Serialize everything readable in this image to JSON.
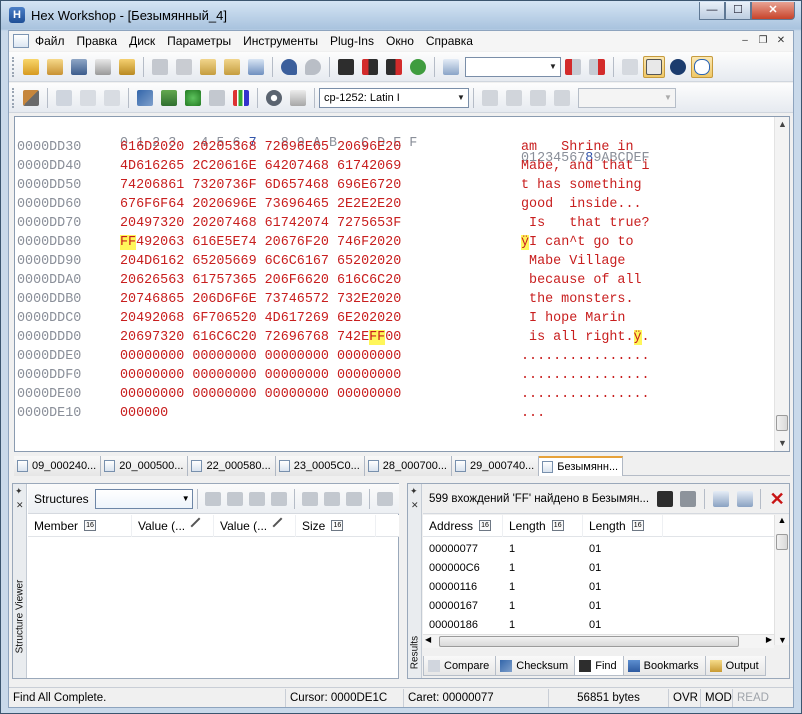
{
  "window": {
    "title": "Hex Workshop - [Безымянный_4]",
    "app_icon_letter": "H",
    "buttons": {
      "minimize": "—",
      "maximize": "☐",
      "close": "✕"
    }
  },
  "menu": {
    "items": [
      "Файл",
      "Правка",
      "Диск",
      "Параметры",
      "Инструменты",
      "Plug-Ins",
      "Окно",
      "Справка"
    ],
    "mdi_buttons": {
      "minimize": "–",
      "restore": "❐",
      "close": "✕"
    }
  },
  "toolbar2": {
    "codepage": "cp-1252: Latin I"
  },
  "hex": {
    "header_offsets": "  0 1 2 3   4 5 6 7   8 9 A B   C D E F   0123456789ABCDEF",
    "rows": [
      {
        "addr": "0000DD30",
        "bytes": "616D2020 20205368 72696E65 20696E20",
        "ascii": "am   Shrine in"
      },
      {
        "addr": "0000DD40",
        "bytes": "4D616265 2C20616E 64207468 61742069",
        "ascii": "Mabe, and that i"
      },
      {
        "addr": "0000DD50",
        "bytes": "74206861 7320736F 6D657468 696E6720",
        "ascii": "t has something "
      },
      {
        "addr": "0000DD60",
        "bytes": "676F6F64 2020696E 73696465 2E2E2E20",
        "ascii": "good  inside... "
      },
      {
        "addr": "0000DD70",
        "bytes": "20497320 20207468 61742074 7275653F",
        "ascii": " Is   that true?"
      },
      {
        "addr": "0000DD80",
        "bytes_pre": "",
        "bytes_hl": "FF",
        "bytes_post": "492063 616E5E74 20676F20 746F2020",
        "ascii_pre": "",
        "ascii_hl": "ÿ",
        "ascii_post": "I can^t go to  "
      },
      {
        "addr": "0000DD90",
        "bytes": "204D6162 65205669 6C6C6167 65202020",
        "ascii": " Mabe Village   "
      },
      {
        "addr": "0000DDA0",
        "bytes": "20626563 61757365 206F6620 616C6C20",
        "ascii": " because of all "
      },
      {
        "addr": "0000DDB0",
        "bytes": "20746865 206D6F6E 73746572 732E2020",
        "ascii": " the monsters.  "
      },
      {
        "addr": "0000DDC0",
        "bytes": "20492068 6F706520 4D617269 6E202020",
        "ascii": " I hope Marin   "
      },
      {
        "addr": "0000DDD0",
        "bytes_pre": "20697320 616C6C20 72696768 742E",
        "bytes_hl": "FF",
        "bytes_post": "00",
        "ascii_pre": " is all right.",
        "ascii_hl": "ÿ",
        "ascii_post": "."
      },
      {
        "addr": "0000DDE0",
        "bytes": "00000000 00000000 00000000 00000000",
        "ascii": "................"
      },
      {
        "addr": "0000DDF0",
        "bytes": "00000000 00000000 00000000 00000000",
        "ascii": "................"
      },
      {
        "addr": "0000DE00",
        "bytes": "00000000 00000000 00000000 00000000",
        "ascii": "................"
      },
      {
        "addr": "0000DE10",
        "bytes": "000000",
        "ascii": "..."
      }
    ]
  },
  "doc_tabs": [
    "09_000240...",
    "20_000500...",
    "22_000580...",
    "23_0005C0...",
    "28_000700...",
    "29_000740...",
    "Безымянн..."
  ],
  "structures": {
    "label": "Structures",
    "side_label": "Structure Viewer",
    "columns": [
      "Member",
      "Value (...",
      "Value (...",
      "Size"
    ]
  },
  "results": {
    "side_label": "Results",
    "message": "599 вхождений 'FF' найдено в Безымян...",
    "columns": [
      "Address",
      "Length",
      "Length"
    ],
    "rows": [
      {
        "address": "00000077",
        "length": "1",
        "length2": "01"
      },
      {
        "address": "000000C6",
        "length": "1",
        "length2": "01"
      },
      {
        "address": "00000116",
        "length": "1",
        "length2": "01"
      },
      {
        "address": "00000167",
        "length": "1",
        "length2": "01"
      },
      {
        "address": "00000186",
        "length": "1",
        "length2": "01"
      }
    ],
    "tabs": [
      "Compare",
      "Checksum",
      "Find",
      "Bookmarks",
      "Output"
    ],
    "active_tab": "Find"
  },
  "status": {
    "message": "Find All Complete.",
    "cursor": "Cursor: 0000DE1C",
    "caret": "Caret: 00000077",
    "size": "56851 bytes",
    "ovr": "OVR",
    "mod": "MOD",
    "read": "READ"
  },
  "colors": {
    "hex_text": "#c81e1e",
    "highlight": "#fff65a",
    "address_text": "#8a8f99"
  }
}
